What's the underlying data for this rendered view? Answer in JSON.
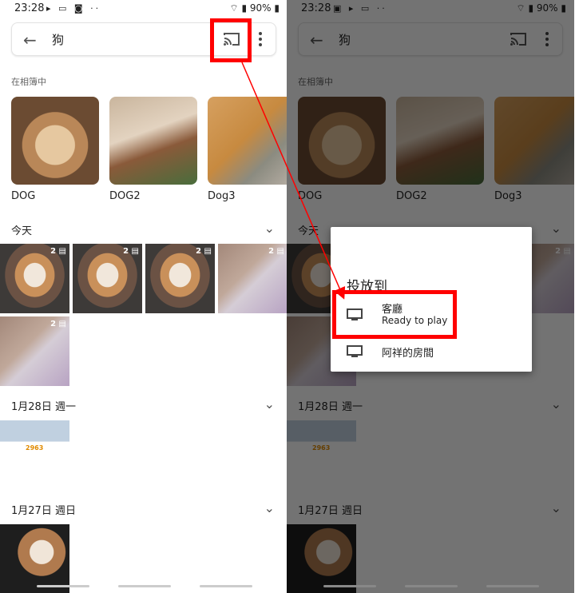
{
  "status": {
    "time": "23:28",
    "battery": "90%"
  },
  "search": {
    "query": "狗"
  },
  "icons": {
    "back": "arrow-back-icon",
    "cast": "cast-icon",
    "more": "more-vert-icon",
    "chevron": "chevron-down-icon",
    "tv": "tv-icon"
  },
  "albums_section": "在相簿中",
  "albums": [
    {
      "name": "DOG"
    },
    {
      "name": "DOG2"
    },
    {
      "name": "Dog3"
    }
  ],
  "sections": [
    {
      "title": "今天",
      "badge": "2"
    },
    {
      "title": "1月28日 週一"
    },
    {
      "title": "1月27日 週日"
    }
  ],
  "screenshot_number": "2963",
  "dialog": {
    "title": "投放到",
    "devices": [
      {
        "name": "客廳",
        "status": "Ready to play"
      },
      {
        "name": "阿祥的房間"
      }
    ]
  },
  "colors": {
    "highlight": "#ff0000",
    "overlay": "#000000"
  }
}
